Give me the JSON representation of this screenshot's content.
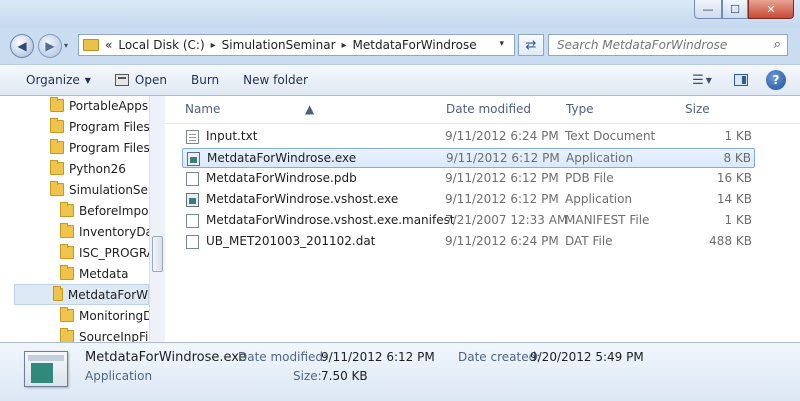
{
  "window": {
    "min_label": "—",
    "max_label": "☐",
    "close_label": "✕"
  },
  "address": {
    "prefix": "«",
    "segments": [
      "Local Disk (C:)",
      "SimulationSeminar",
      "MetdataForWindrose"
    ],
    "separator": "▸",
    "dropdown": "▾"
  },
  "search": {
    "placeholder": "Search MetdataForWindrose"
  },
  "toolbar": {
    "organize": "Organize",
    "open": "Open",
    "burn": "Burn",
    "new_folder": "New folder",
    "dropdown_arrow": "▼",
    "help": "?"
  },
  "nav": {
    "items": [
      {
        "label": "PortableApps",
        "indent": 1
      },
      {
        "label": "Program Files",
        "indent": 1
      },
      {
        "label": "Program Files (",
        "indent": 1
      },
      {
        "label": "Python26",
        "indent": 1
      },
      {
        "label": "SimulationSemi",
        "indent": 1
      },
      {
        "label": "BeforeImport",
        "indent": 2
      },
      {
        "label": "InventoryDat",
        "indent": 2
      },
      {
        "label": "ISC_PROGRA",
        "indent": 2
      },
      {
        "label": "Metdata",
        "indent": 2
      },
      {
        "label": "MetdataForW",
        "indent": 2,
        "selected": true
      },
      {
        "label": "MonitoringD",
        "indent": 2
      },
      {
        "label": "SourceInpFile",
        "indent": 2
      }
    ]
  },
  "columns": {
    "name": "Name",
    "date": "Date modified",
    "type": "Type",
    "size": "Size",
    "sort_indicator": "▲"
  },
  "files": [
    {
      "name": "Input.txt",
      "date": "9/11/2012 6:24 PM",
      "type": "Text Document",
      "size": "1 KB",
      "icon": "text-file-icon"
    },
    {
      "name": "MetdataForWindrose.exe",
      "date": "9/11/2012 6:12 PM",
      "type": "Application",
      "size": "8 KB",
      "icon": "application-icon",
      "selected": true
    },
    {
      "name": "MetdataForWindrose.pdb",
      "date": "9/11/2012 6:12 PM",
      "type": "PDB File",
      "size": "16 KB",
      "icon": "file-icon"
    },
    {
      "name": "MetdataForWindrose.vshost.exe",
      "date": "9/11/2012 6:12 PM",
      "type": "Application",
      "size": "14 KB",
      "icon": "application-icon"
    },
    {
      "name": "MetdataForWindrose.vshost.exe.manifest",
      "date": "7/21/2007 12:33 AM",
      "type": "MANIFEST File",
      "size": "1 KB",
      "icon": "file-icon"
    },
    {
      "name": "UB_MET201003_201102.dat",
      "date": "9/11/2012 6:24 PM",
      "type": "DAT File",
      "size": "488 KB",
      "icon": "file-icon"
    }
  ],
  "details": {
    "filename": "MetdataForWindrose.exe",
    "filetype": "Application",
    "date_modified_label": "Date modified:",
    "date_modified": "9/11/2012 6:12 PM",
    "date_created_label": "Date created:",
    "date_created": "9/20/2012 5:49 PM",
    "size_label": "Size:",
    "size": "7.50 KB"
  }
}
